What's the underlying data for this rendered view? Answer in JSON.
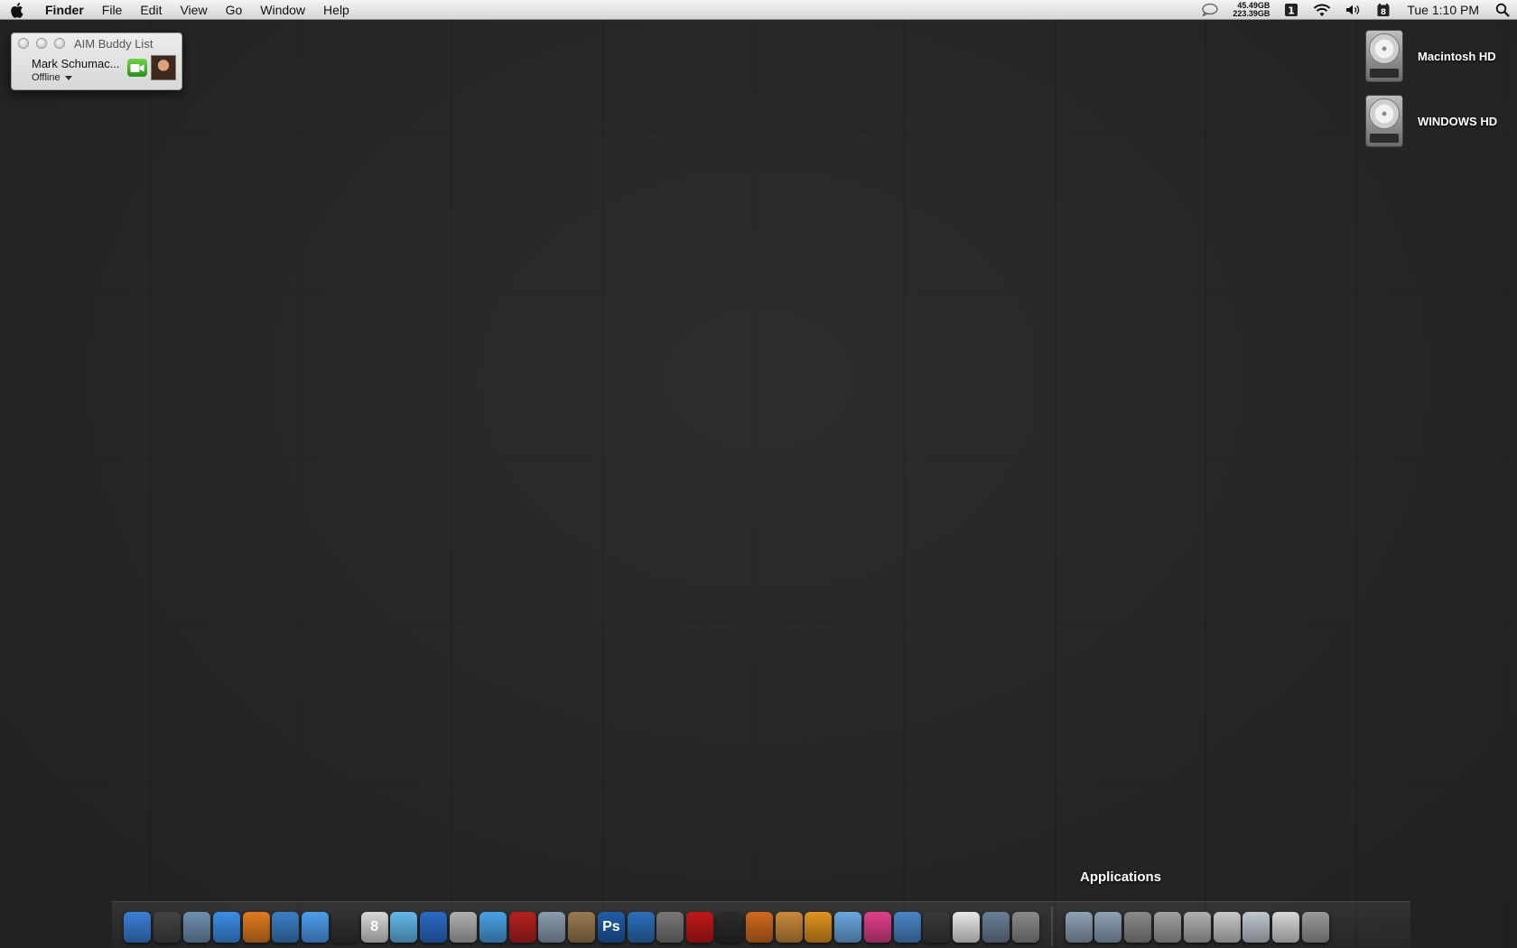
{
  "menubar": {
    "app_name": "Finder",
    "items": [
      "File",
      "Edit",
      "View",
      "Go",
      "Window",
      "Help"
    ],
    "disk_usage": {
      "used": "45.49GB",
      "total": "223.39GB"
    },
    "clock": "Tue 1:10 PM"
  },
  "aim": {
    "title": "AIM Buddy List",
    "name": "Mark Schumac...",
    "status": "Offline"
  },
  "desktop": {
    "disks": [
      {
        "label": "Macintosh HD"
      },
      {
        "label": "WINDOWS HD"
      }
    ]
  },
  "dock": {
    "tooltip": "Applications",
    "apps": [
      {
        "name": "finder-icon",
        "color": "#3b7fd8"
      },
      {
        "name": "dashboard-icon",
        "color": "#444444"
      },
      {
        "name": "mail-icon",
        "color": "#6f8fb0"
      },
      {
        "name": "safari-icon",
        "color": "#3c8ee8"
      },
      {
        "name": "firefox-icon",
        "color": "#e07b1f"
      },
      {
        "name": "network-utility-icon",
        "color": "#3a7fc4"
      },
      {
        "name": "ichat-icon",
        "color": "#4e9ef0"
      },
      {
        "name": "pen-icon",
        "color": "#333333"
      },
      {
        "name": "ical-icon",
        "color": "#d8d8d8",
        "text": "8"
      },
      {
        "name": "itunes-icon",
        "color": "#63b8ea"
      },
      {
        "name": "quicktime-icon",
        "color": "#2a6cc8"
      },
      {
        "name": "script-editor-icon",
        "color": "#b0b0b0"
      },
      {
        "name": "bluetooth-icon",
        "color": "#49a1e5"
      },
      {
        "name": "photo-booth-icon",
        "color": "#b52020"
      },
      {
        "name": "iphoto-icon",
        "color": "#8a9db0"
      },
      {
        "name": "preview-icon",
        "color": "#9a7a50"
      },
      {
        "name": "photoshop-icon",
        "color": "#1f5ea8",
        "text": "Ps"
      },
      {
        "name": "word-icon",
        "color": "#2b6fba"
      },
      {
        "name": "imovie-icon",
        "color": "#777777"
      },
      {
        "name": "front-row-icon",
        "color": "#c01818"
      },
      {
        "name": "final-cut-icon",
        "color": "#2b2b2b"
      },
      {
        "name": "blender-icon",
        "color": "#d06a1e"
      },
      {
        "name": "garageband-icon",
        "color": "#c98a3a"
      },
      {
        "name": "system-gear-icon",
        "color": "#e0941e"
      },
      {
        "name": "alarm-clock-icon",
        "color": "#6aa8e0"
      },
      {
        "name": "ipod-icon",
        "color": "#e03f8c"
      },
      {
        "name": "globe-icon",
        "color": "#4a86c8"
      },
      {
        "name": "pen-tool-icon",
        "color": "#3a3a3a"
      },
      {
        "name": "textedit-icon",
        "color": "#e8e8e8"
      },
      {
        "name": "activity-monitor-icon",
        "color": "#6a7f95"
      },
      {
        "name": "system-preferences-icon",
        "color": "#8a8a8a"
      }
    ],
    "folders": [
      {
        "name": "applications-folder-icon",
        "color": "#8da1b5"
      },
      {
        "name": "downloads-folder-icon",
        "color": "#8da1b5"
      },
      {
        "name": "documents-folder-icon",
        "color": "#8a8a8a"
      },
      {
        "name": "stack-folder-icon-1",
        "color": "#a0a0a0"
      },
      {
        "name": "stack-folder-icon-2",
        "color": "#b0b0b0"
      },
      {
        "name": "stack-folder-icon-3",
        "color": "#c8c8c8"
      },
      {
        "name": "stack-folder-icon-4",
        "color": "#c0c8d0"
      },
      {
        "name": "stack-folder-icon-5",
        "color": "#d8d8d8"
      },
      {
        "name": "trash-icon",
        "color": "#9a9a9a"
      }
    ]
  }
}
